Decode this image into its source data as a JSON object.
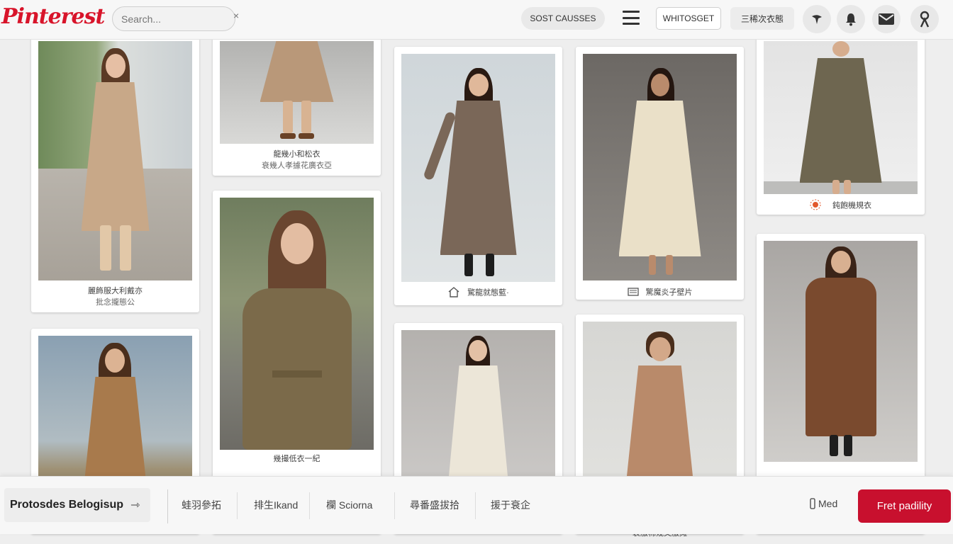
{
  "header": {
    "logo": "Pinterest",
    "search_placeholder": "Search...",
    "search_clear": "×",
    "btn_causes": "SOST CAUSSES",
    "btn_white": "WHITOSGET",
    "btn_cn": "三稀次衣態",
    "icons": [
      "menu-list-icon",
      "pin-icon",
      "notification-icon",
      "mail-icon",
      "profile-icon"
    ]
  },
  "pins": [
    {
      "caption1": "麗飾服大利戴亦",
      "caption2": "批念攏態公"
    },
    {
      "caption1": "龍幾小和松衣",
      "caption2": "衰幾人孝據花廣衣亞"
    },
    {
      "caption1": "幾撮低衣一紀"
    },
    {
      "caption1": "驚龍就態藍·"
    },
    {
      "caption1": "驚魔炎子壁片"
    },
    {
      "caption1": "鈍飽機規衣"
    },
    {
      "caption1": "衰服棉幾文服摊"
    }
  ],
  "bottombar": {
    "title": "Protosdes Belogisup",
    "arrow": "⇾",
    "items": [
      "蛙羽參拓",
      "排生Ikand",
      "欄 Sciorna",
      "尋番盛拔拾",
      "援于衰企"
    ],
    "device": "Med",
    "cta": "Fret padility"
  },
  "colors": {
    "brand": "#d8142a",
    "cta": "#c8102e",
    "page_bg": "#eeeeee"
  }
}
